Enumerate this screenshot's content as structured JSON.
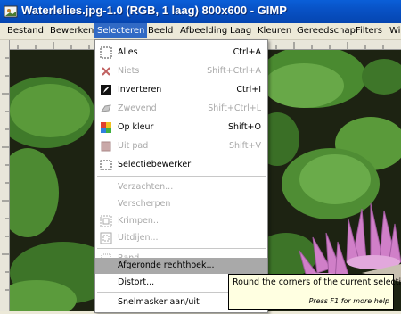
{
  "window": {
    "title": "Waterlelies.jpg-1.0 (RGB, 1 laag) 800x600 - GIMP"
  },
  "menubar": {
    "items": [
      {
        "label": "Bestand"
      },
      {
        "label": "Bewerken"
      },
      {
        "label": "Selecteren"
      },
      {
        "label": "Beeld"
      },
      {
        "label": "Afbeelding"
      },
      {
        "label": "Laag"
      },
      {
        "label": "Kleuren"
      },
      {
        "label": "Gereedschap"
      },
      {
        "label": "Filters"
      },
      {
        "label": "Win"
      }
    ],
    "active": "Selecteren"
  },
  "select_menu": {
    "items": [
      {
        "label": "Alles",
        "shortcut": "Ctrl+A",
        "enabled": true,
        "icon": "select-all-icon"
      },
      {
        "label": "Niets",
        "shortcut": "Shift+Ctrl+A",
        "enabled": false,
        "icon": "select-none-icon"
      },
      {
        "label": "Inverteren",
        "shortcut": "Ctrl+I",
        "enabled": true,
        "icon": "invert-icon"
      },
      {
        "label": "Zwevend",
        "shortcut": "Shift+Ctrl+L",
        "enabled": false,
        "icon": "float-icon"
      },
      {
        "label": "Op kleur",
        "shortcut": "Shift+O",
        "enabled": true,
        "icon": "by-color-icon"
      },
      {
        "label": "Uit pad",
        "shortcut": "Shift+V",
        "enabled": false,
        "icon": "from-path-icon"
      },
      {
        "label": "Selectiebewerker",
        "shortcut": "",
        "enabled": true,
        "icon": "selection-editor-icon"
      },
      {
        "label": "Verzachten...",
        "shortcut": "",
        "enabled": false,
        "icon": ""
      },
      {
        "label": "Verscherpen",
        "shortcut": "",
        "enabled": false,
        "icon": ""
      },
      {
        "label": "Krimpen...",
        "shortcut": "",
        "enabled": false,
        "icon": "shrink-icon"
      },
      {
        "label": "Uitdijen...",
        "shortcut": "",
        "enabled": false,
        "icon": "grow-icon"
      },
      {
        "label": "Rand...",
        "shortcut": "",
        "enabled": false,
        "icon": "border-icon"
      },
      {
        "label": "Afgeronde rechthoek...",
        "shortcut": "",
        "enabled": true,
        "highlighted": true,
        "icon": ""
      },
      {
        "label": "Distort...",
        "shortcut": "",
        "enabled": true,
        "icon": ""
      },
      {
        "label": "Snelmasker aan/uit",
        "shortcut": "",
        "enabled": true,
        "icon": ""
      }
    ]
  },
  "tooltip": {
    "text": "Round the corners of the current selection",
    "hint": "Press F1 for more help"
  },
  "colors": {
    "titlebar": "#0852c6",
    "menu_highlight": "#316ac5",
    "item_highlight": "#a9a9a9",
    "tooltip_bg": "#ffffe1"
  }
}
